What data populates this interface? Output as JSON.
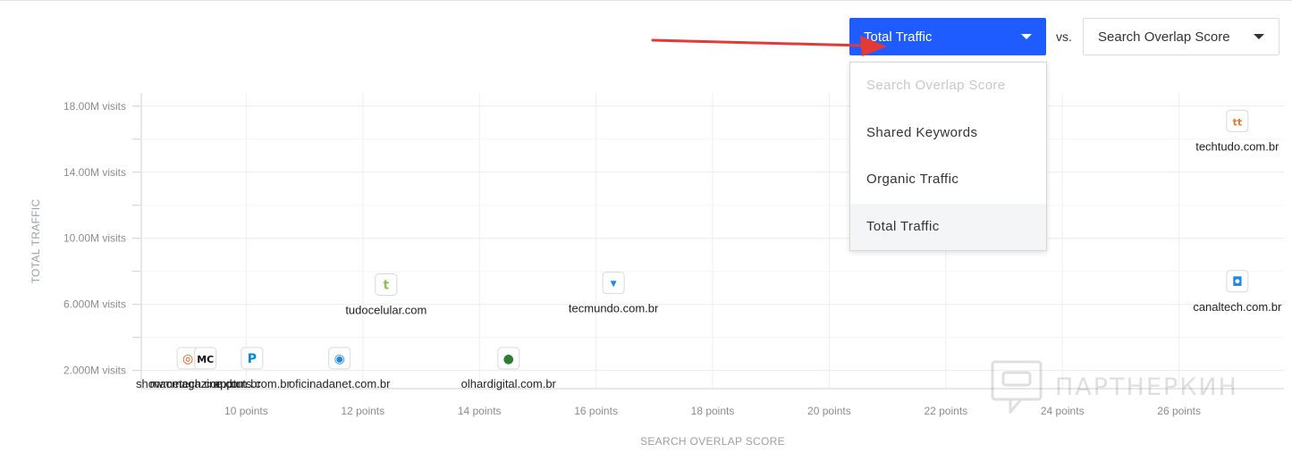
{
  "controls": {
    "y_metric": "Total Traffic",
    "vs": "vs.",
    "x_metric": "Search Overlap Score",
    "menu_items": [
      {
        "label": "Search Overlap Score",
        "state": "disabled"
      },
      {
        "label": "Shared Keywords",
        "state": "normal"
      },
      {
        "label": "Organic Traffic",
        "state": "normal"
      },
      {
        "label": "Total Traffic",
        "state": "selected"
      }
    ],
    "accent_color": "#1f5cff"
  },
  "chart_data": {
    "type": "scatter",
    "xlabel": "SEARCH OVERLAP SCORE",
    "ylabel": "TOTAL TRAFFIC",
    "xlim": [
      8.2,
      27.8
    ],
    "ylim": [
      0.9,
      18.8
    ],
    "x_ticks": [
      {
        "value": 10,
        "label": "10 points"
      },
      {
        "value": 12,
        "label": "12 points"
      },
      {
        "value": 14,
        "label": "14 points"
      },
      {
        "value": 16,
        "label": "16 points"
      },
      {
        "value": 18,
        "label": "18 points"
      },
      {
        "value": 20,
        "label": "20 points"
      },
      {
        "value": 22,
        "label": "22 points"
      },
      {
        "value": 24,
        "label": "24 points"
      },
      {
        "value": 26,
        "label": "26 points"
      }
    ],
    "y_ticks": [
      {
        "value": 2,
        "label": "2.000M visits"
      },
      {
        "value": 6,
        "label": "6.000M visits"
      },
      {
        "value": 10,
        "label": "10.00M visits"
      },
      {
        "value": 14,
        "label": "14.00M visits"
      },
      {
        "value": 18,
        "label": "18.00M visits"
      }
    ],
    "grid": true,
    "points": [
      {
        "label": "techtudo.com.br",
        "x": 27.0,
        "y": 17.1,
        "icon": "techtudo-logo",
        "color": "#e07a2a",
        "glyph": "tt"
      },
      {
        "label": "canaltech.com.br",
        "x": 27.0,
        "y": 7.4,
        "icon": "canaltech-logo",
        "color": "#1e88e5",
        "glyph": "◘"
      },
      {
        "label": "tudocelular.com",
        "x": 12.4,
        "y": 7.2,
        "icon": "tudocelular-logo",
        "color": "#8bc34a",
        "glyph": "t"
      },
      {
        "label": "tecmundo.com.br",
        "x": 16.3,
        "y": 7.3,
        "icon": "tecmundo-logo",
        "color": "#1e88e5",
        "glyph": "▾"
      },
      {
        "label": "oficinadanet.com.br",
        "x": 11.6,
        "y": 2.2,
        "icon": "oficinadanet-logo",
        "color": "#1e88e5",
        "glyph": "◉"
      },
      {
        "label": "olhardigital.com.br",
        "x": 14.5,
        "y": 1.7,
        "icon": "olhardigital-logo",
        "color": "#2e7d32",
        "glyph": "●"
      },
      {
        "label": "showmetech.com.br",
        "x": 9.0,
        "y": 0.6,
        "icon": "showmetech-logo",
        "color": "#e65100",
        "glyph": "◎"
      },
      {
        "label": "macmagazine.com.br",
        "x": 9.3,
        "y": 0.7,
        "icon": "macmagazine-logo",
        "color": "#111111",
        "glyph": "MC"
      },
      {
        "label": "apptuts.com.br",
        "x": 10.1,
        "y": 0.7,
        "icon": "pplware-logo",
        "color": "#0288d1",
        "glyph": "P"
      }
    ]
  },
  "watermark": "ПАРТНЕРКИН"
}
